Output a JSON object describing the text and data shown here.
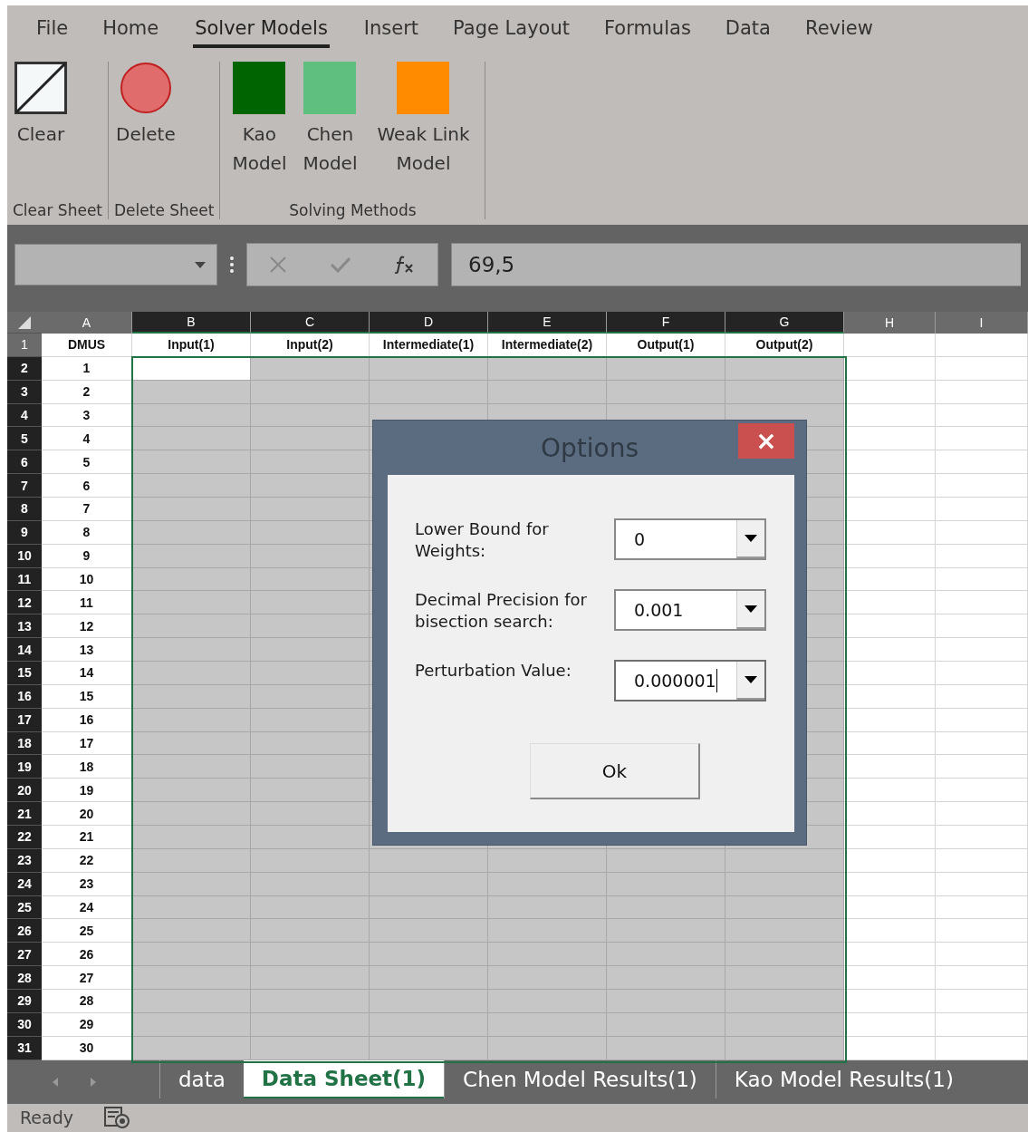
{
  "ribbon_tabs": [
    {
      "label": "File",
      "selected": false
    },
    {
      "label": "Home",
      "selected": false
    },
    {
      "label": "Solver Models",
      "selected": true
    },
    {
      "label": "Insert",
      "selected": false
    },
    {
      "label": "Page Layout",
      "selected": false
    },
    {
      "label": "Formulas",
      "selected": false
    },
    {
      "label": "Data",
      "selected": false
    },
    {
      "label": "Review",
      "selected": false
    }
  ],
  "ribbon_groups": [
    {
      "label": "Clear Sheet",
      "buttons": [
        {
          "label": "Clear",
          "kind": "diagonal-box"
        }
      ]
    },
    {
      "label": "Delete Sheet",
      "buttons": [
        {
          "label": "Delete",
          "kind": "circle",
          "color": "#e06c6c"
        }
      ]
    },
    {
      "label": "Solving Methods",
      "buttons": [
        {
          "label": "Kao Model",
          "kind": "square",
          "color": "#006400"
        },
        {
          "label": "Chen Model",
          "kind": "square",
          "color": "#5fbf7f"
        },
        {
          "label": "Weak Link Model",
          "kind": "square",
          "color": "#ff8c00"
        }
      ]
    }
  ],
  "formula_bar": {
    "value": "69,5"
  },
  "columns": [
    {
      "label": "A",
      "selected": false
    },
    {
      "label": "B",
      "selected": true
    },
    {
      "label": "C",
      "selected": true
    },
    {
      "label": "D",
      "selected": true
    },
    {
      "label": "E",
      "selected": true
    },
    {
      "label": "F",
      "selected": true
    },
    {
      "label": "G",
      "selected": true
    },
    {
      "label": "H",
      "selected": false
    },
    {
      "label": "I",
      "selected": false
    }
  ],
  "rows": [
    {
      "number": "1",
      "selected": false,
      "active": false,
      "cells": [
        "DMUS",
        "Input(1)",
        "Input(2)",
        "Intermediate(1)",
        "Intermediate(2)",
        "Output(1)",
        "Output(2)"
      ]
    },
    {
      "number": "2",
      "selected": true,
      "active": true,
      "cells": [
        "1"
      ]
    },
    {
      "number": "3",
      "selected": true,
      "active": false,
      "cells": [
        "2"
      ]
    },
    {
      "number": "4",
      "selected": true,
      "active": false,
      "cells": [
        "3"
      ]
    },
    {
      "number": "5",
      "selected": true,
      "active": false,
      "cells": [
        "4"
      ]
    },
    {
      "number": "6",
      "selected": true,
      "active": false,
      "cells": [
        "5"
      ]
    },
    {
      "number": "7",
      "selected": true,
      "active": false,
      "cells": [
        "6"
      ]
    },
    {
      "number": "8",
      "selected": true,
      "active": false,
      "cells": [
        "7"
      ]
    },
    {
      "number": "9",
      "selected": true,
      "active": false,
      "cells": [
        "8"
      ]
    },
    {
      "number": "10",
      "selected": true,
      "active": false,
      "cells": [
        "9"
      ]
    },
    {
      "number": "11",
      "selected": true,
      "active": false,
      "cells": [
        "10"
      ]
    },
    {
      "number": "12",
      "selected": true,
      "active": false,
      "cells": [
        "11"
      ]
    },
    {
      "number": "13",
      "selected": true,
      "active": false,
      "cells": [
        "12"
      ]
    },
    {
      "number": "14",
      "selected": true,
      "active": false,
      "cells": [
        "13"
      ]
    },
    {
      "number": "15",
      "selected": true,
      "active": false,
      "cells": [
        "14"
      ]
    },
    {
      "number": "16",
      "selected": true,
      "active": false,
      "cells": [
        "15"
      ]
    },
    {
      "number": "17",
      "selected": true,
      "active": false,
      "cells": [
        "16"
      ]
    },
    {
      "number": "18",
      "selected": true,
      "active": false,
      "cells": [
        "17"
      ]
    },
    {
      "number": "19",
      "selected": true,
      "active": false,
      "cells": [
        "18"
      ]
    },
    {
      "number": "20",
      "selected": true,
      "active": false,
      "cells": [
        "19"
      ]
    },
    {
      "number": "21",
      "selected": true,
      "active": false,
      "cells": [
        "20"
      ]
    },
    {
      "number": "22",
      "selected": true,
      "active": false,
      "cells": [
        "21"
      ]
    },
    {
      "number": "23",
      "selected": true,
      "active": false,
      "cells": [
        "22"
      ]
    },
    {
      "number": "24",
      "selected": true,
      "active": false,
      "cells": [
        "23"
      ]
    },
    {
      "number": "25",
      "selected": true,
      "active": false,
      "cells": [
        "24"
      ]
    },
    {
      "number": "26",
      "selected": true,
      "active": false,
      "cells": [
        "25"
      ]
    },
    {
      "number": "27",
      "selected": true,
      "active": false,
      "cells": [
        "26"
      ]
    },
    {
      "number": "28",
      "selected": true,
      "active": false,
      "cells": [
        "27"
      ]
    },
    {
      "number": "29",
      "selected": true,
      "active": false,
      "cells": [
        "28"
      ]
    },
    {
      "number": "30",
      "selected": true,
      "active": false,
      "cells": [
        "29"
      ]
    },
    {
      "number": "31",
      "selected": true,
      "active": false,
      "cells": [
        "30"
      ]
    }
  ],
  "dialog": {
    "title": "Options",
    "close": "×",
    "fields": [
      {
        "label": "Lower Bound for Weights:",
        "value": "0",
        "focused": false
      },
      {
        "label": "Decimal Precision for bisection search:",
        "value": "0.001",
        "focused": false
      },
      {
        "label": "Perturbation Value:",
        "value": "0.000001",
        "focused": true
      }
    ],
    "button": "Ok"
  },
  "sheet_tabs": [
    {
      "label": "data",
      "selected": false
    },
    {
      "label": "Data Sheet(1)",
      "selected": true
    },
    {
      "label": "Chen Model Results(1)",
      "selected": false
    },
    {
      "label": "Kao Model Results(1)",
      "selected": false
    }
  ],
  "status_bar": {
    "text": "Ready"
  }
}
